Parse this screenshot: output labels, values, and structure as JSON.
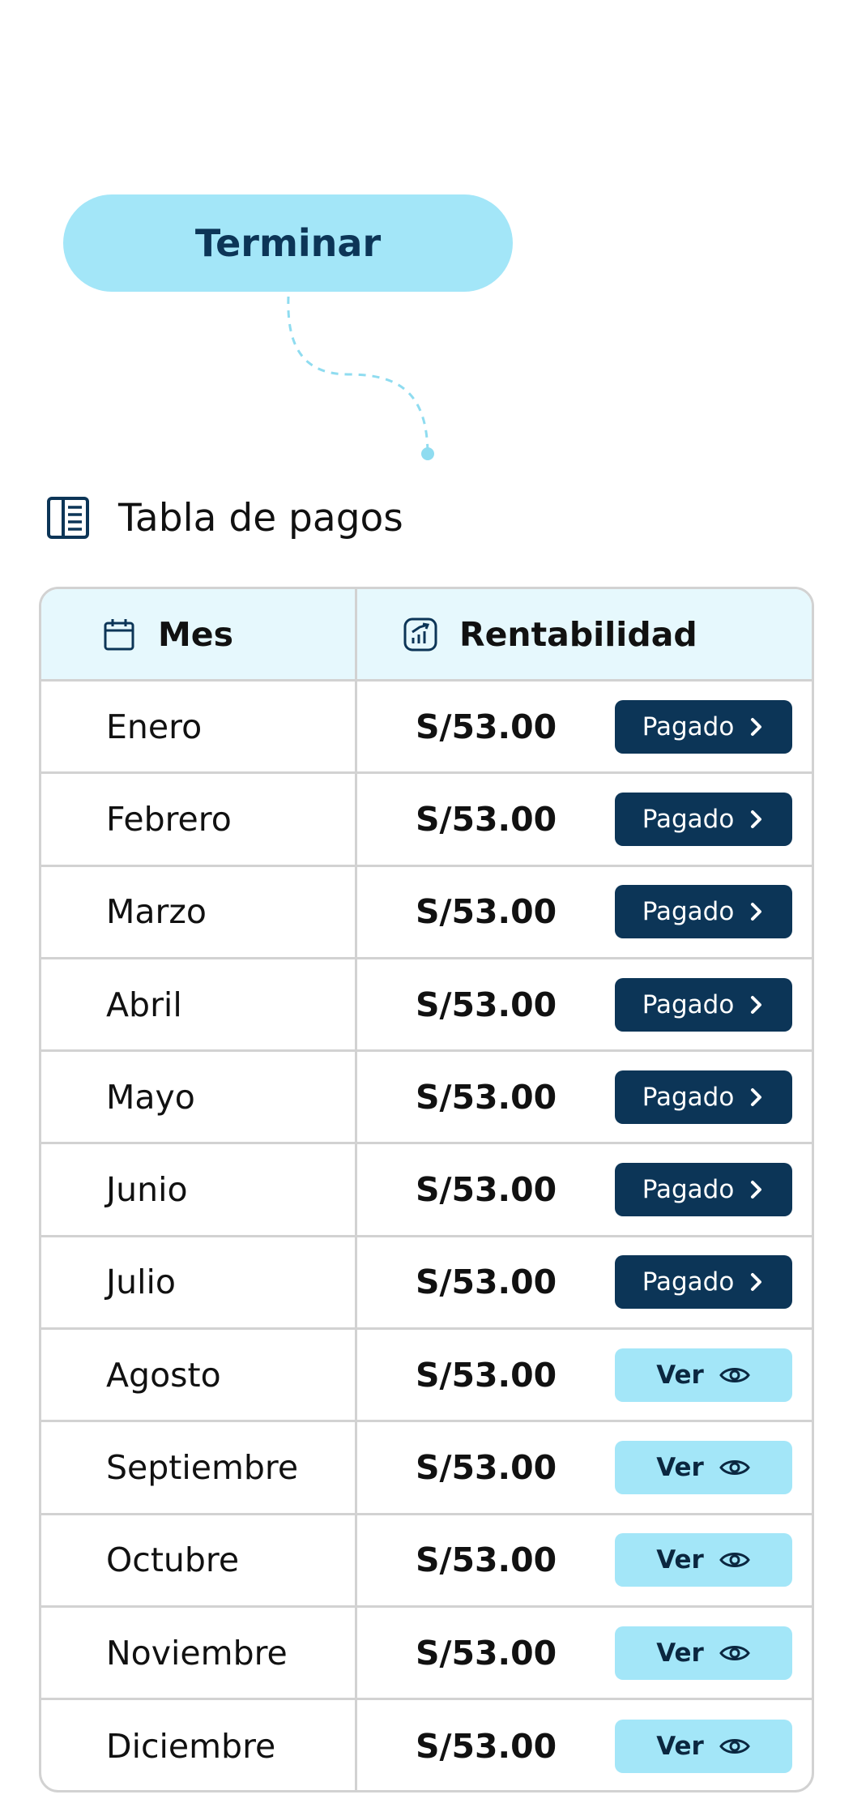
{
  "finish_button": {
    "label": "Terminar"
  },
  "section": {
    "title": "Tabla de pagos",
    "icon": "table-list-icon"
  },
  "table": {
    "headers": {
      "month": {
        "label": "Mes",
        "icon": "calendar-icon"
      },
      "return": {
        "label": "Rentabilidad",
        "icon": "chart-growth-icon"
      }
    },
    "rows": [
      {
        "month": "Enero",
        "amount": "S/53.00",
        "status": "Pagado",
        "kind": "paid"
      },
      {
        "month": "Febrero",
        "amount": "S/53.00",
        "status": "Pagado",
        "kind": "paid"
      },
      {
        "month": "Marzo",
        "amount": "S/53.00",
        "status": "Pagado",
        "kind": "paid"
      },
      {
        "month": "Abril",
        "amount": "S/53.00",
        "status": "Pagado",
        "kind": "paid"
      },
      {
        "month": "Mayo",
        "amount": "S/53.00",
        "status": "Pagado",
        "kind": "paid"
      },
      {
        "month": "Junio",
        "amount": "S/53.00",
        "status": "Pagado",
        "kind": "paid"
      },
      {
        "month": "Julio",
        "amount": "S/53.00",
        "status": "Pagado",
        "kind": "paid"
      },
      {
        "month": "Agosto",
        "amount": "S/53.00",
        "status": "Ver",
        "kind": "view"
      },
      {
        "month": "Septiembre",
        "amount": "S/53.00",
        "status": "Ver",
        "kind": "view"
      },
      {
        "month": "Octubre",
        "amount": "S/53.00",
        "status": "Ver",
        "kind": "view"
      },
      {
        "month": "Noviembre",
        "amount": "S/53.00",
        "status": "Ver",
        "kind": "view"
      },
      {
        "month": "Diciembre",
        "amount": "S/53.00",
        "status": "Ver",
        "kind": "view"
      }
    ]
  },
  "colors": {
    "navy": "#0c3557",
    "light_blue": "#a3e6f8",
    "header_bg": "#e6f8fd",
    "border": "#d2d2d2"
  }
}
